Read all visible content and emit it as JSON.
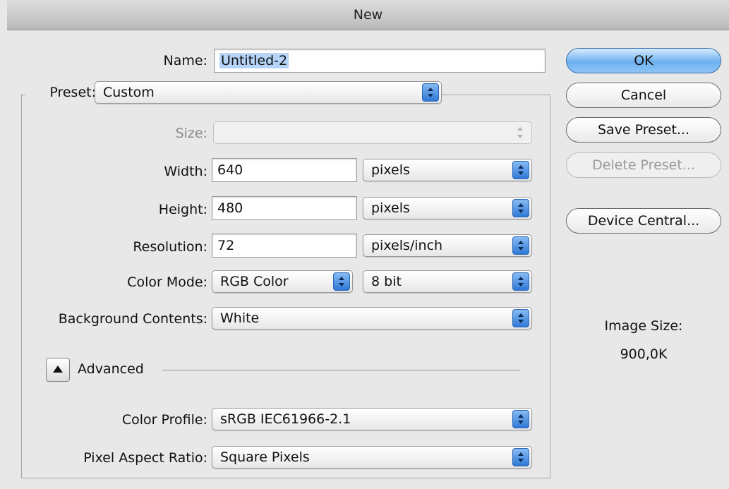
{
  "window": {
    "title": "New"
  },
  "form": {
    "name": {
      "label": "Name:",
      "value": "Untitled-2"
    },
    "preset": {
      "label": "Preset:",
      "value": "Custom"
    },
    "size": {
      "label": "Size:",
      "value": ""
    },
    "width": {
      "label": "Width:",
      "value": "640",
      "unit": "pixels"
    },
    "height": {
      "label": "Height:",
      "value": "480",
      "unit": "pixels"
    },
    "resolution": {
      "label": "Resolution:",
      "value": "72",
      "unit": "pixels/inch"
    },
    "color_mode": {
      "label": "Color Mode:",
      "value": "RGB Color",
      "bit_depth": "8 bit"
    },
    "background": {
      "label": "Background Contents:",
      "value": "White"
    },
    "advanced": {
      "label": "Advanced"
    },
    "color_profile": {
      "label": "Color Profile:",
      "value": "sRGB IEC61966-2.1"
    },
    "pixel_aspect": {
      "label": "Pixel Aspect Ratio:",
      "value": "Square Pixels"
    }
  },
  "buttons": {
    "ok": "OK",
    "cancel": "Cancel",
    "save_preset": "Save Preset...",
    "delete_preset": "Delete Preset...",
    "device_central": "Device Central..."
  },
  "image_size": {
    "label": "Image Size:",
    "value": "900,0K"
  },
  "colors": {
    "accent": "#5aa6ee",
    "selection": "#b5d4f7"
  }
}
